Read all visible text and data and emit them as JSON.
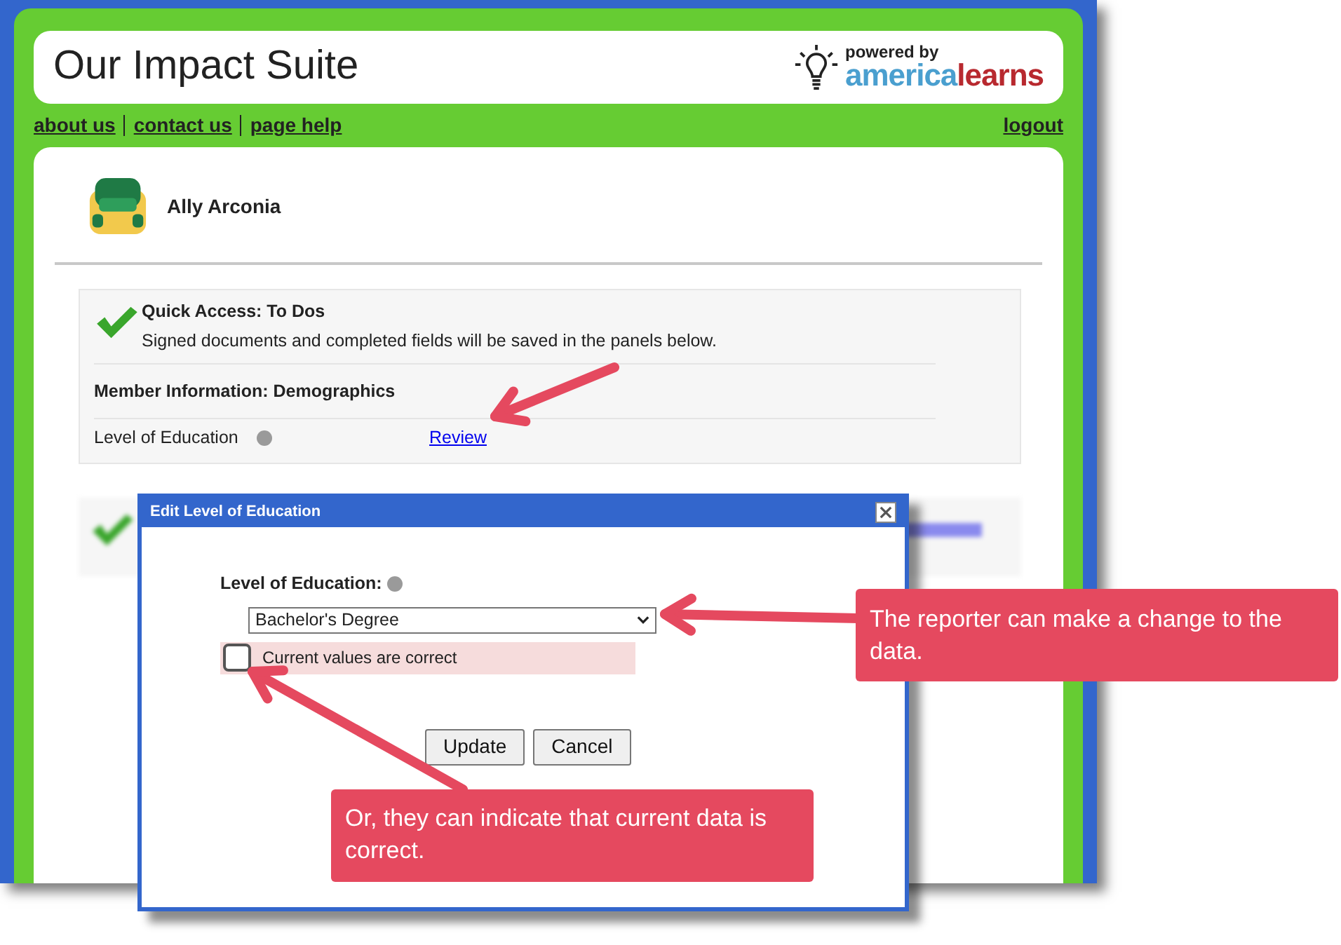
{
  "header": {
    "title": "Our Impact Suite",
    "logo_small": "powered by",
    "logo_brand_a": "america",
    "logo_brand_b": "learns"
  },
  "nav": {
    "links": [
      "about us",
      "contact us",
      "page help"
    ],
    "logout": "logout"
  },
  "user": {
    "name": "Ally Arconia"
  },
  "quick_access": {
    "title": "Quick Access: To Dos",
    "description": "Signed documents and completed fields will be saved in the panels below.",
    "section": "Member Information: Demographics",
    "field": "Level of Education",
    "action": "Review"
  },
  "dialog": {
    "title": "Edit Level of Education",
    "field_label": "Level of Education:",
    "value": "Bachelor's Degree",
    "confirm": {
      "label": "Current values are correct",
      "checked": false
    },
    "buttons": [
      "Update",
      "Cancel"
    ]
  },
  "callouts": [
    "The reporter can make a change to the data.",
    "Or, they can indicate that current data is correct."
  ]
}
